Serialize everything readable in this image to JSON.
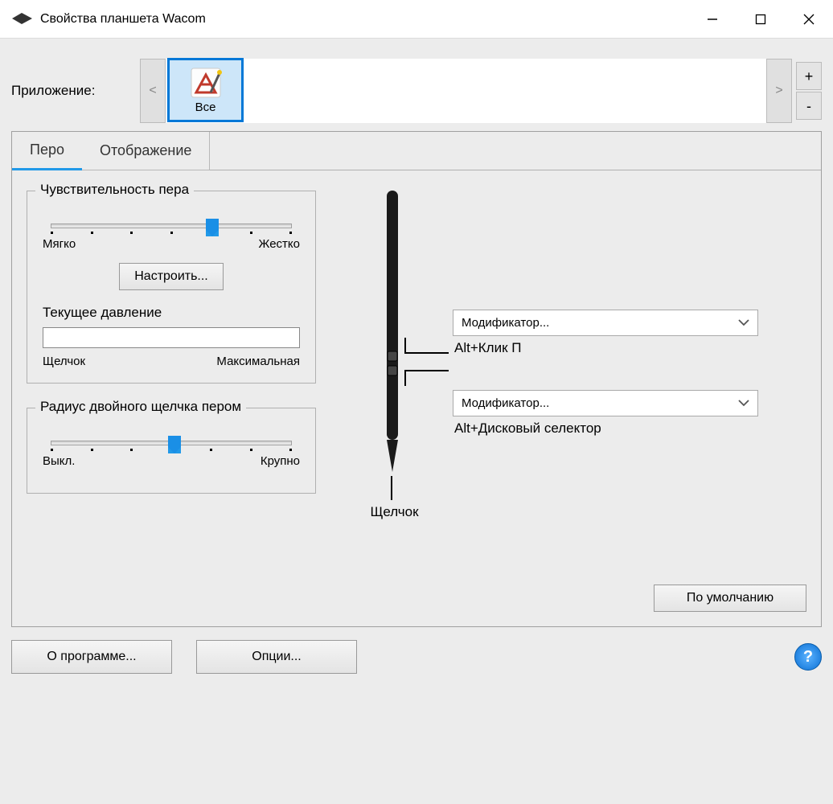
{
  "title": "Свойства планшета Wacom",
  "application": {
    "label": "Приложение:",
    "prev_glyph": "<",
    "next_glyph": ">",
    "add_glyph": "+",
    "remove_glyph": "-",
    "selected_label": "Все"
  },
  "tabs": {
    "pen": "Перо",
    "mapping": "Отображение"
  },
  "tip_feel": {
    "title": "Чувствительность пера",
    "soft": "Мягко",
    "firm": "Жестко",
    "customize": "Настроить...",
    "pressure_label": "Текущее давление",
    "click": "Щелчок",
    "max": "Максимальная"
  },
  "dbl_click": {
    "title": "Радиус двойного щелчка пером",
    "off": "Выкл.",
    "large": "Крупно"
  },
  "pen_map": {
    "button_upper": {
      "value": "Модификатор...",
      "sub": "Alt+Клик П"
    },
    "button_lower": {
      "value": "Модификатор...",
      "sub": "Alt+Дисковый селектор"
    },
    "tip_label": "Щелчок"
  },
  "buttons": {
    "default": "По умолчанию",
    "about": "О программе...",
    "options": "Опции..."
  }
}
